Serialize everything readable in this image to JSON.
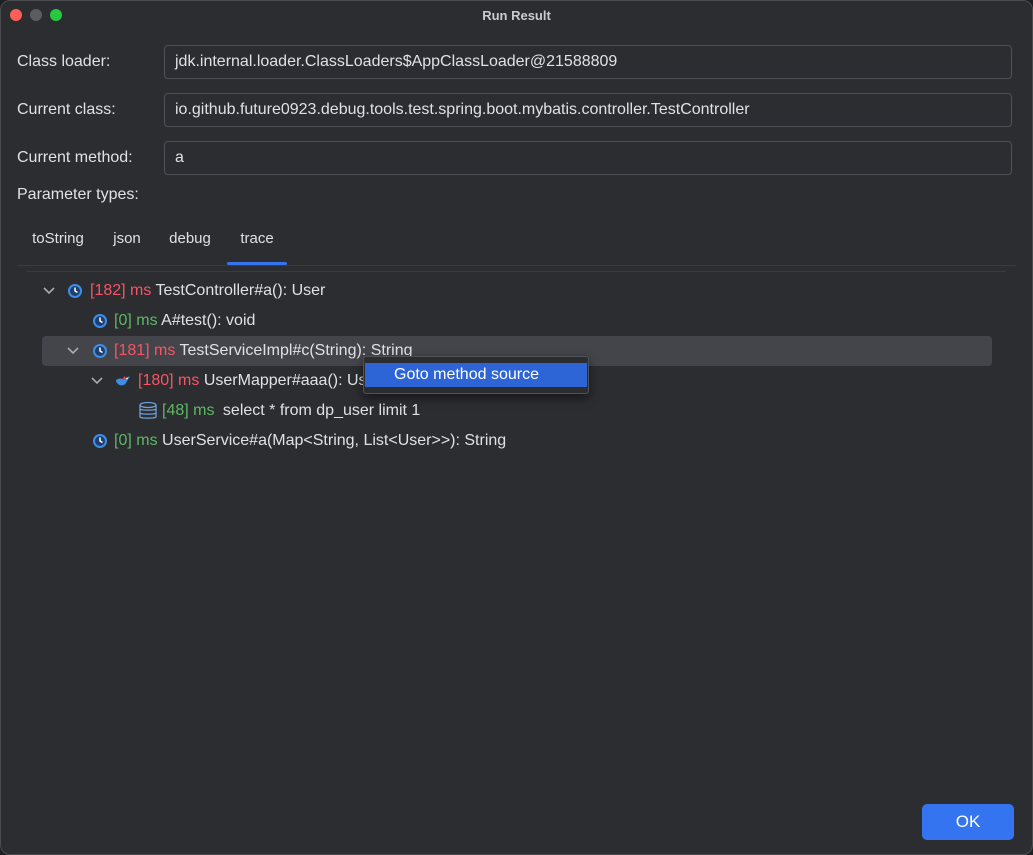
{
  "window": {
    "title": "Run Result"
  },
  "form": {
    "class_loader_label": "Class loader:",
    "class_loader_value": "jdk.internal.loader.ClassLoaders$AppClassLoader@21588809",
    "current_class_label": "Current class:",
    "current_class_value": "io.github.future0923.debug.tools.test.spring.boot.mybatis.controller.TestController",
    "current_method_label": "Current method:",
    "current_method_value": "a",
    "parameter_types_label": "Parameter types:"
  },
  "tabs": [
    {
      "label": "toString",
      "active": false
    },
    {
      "label": "json",
      "active": false
    },
    {
      "label": "debug",
      "active": false
    },
    {
      "label": "trace",
      "active": true
    }
  ],
  "trace_tree": [
    {
      "cost": "[182]",
      "unit": "ms",
      "signature": "TestController#a(): User",
      "icon": "clock-icon",
      "expanded": true,
      "cost_color": "#f75464"
    },
    {
      "cost": "[0]",
      "unit": "ms",
      "signature": "A#test(): void",
      "icon": "clock-icon",
      "cost_color": "#5fb865"
    },
    {
      "cost": "[181]",
      "unit": "ms",
      "signature": "TestServiceImpl#c(String): String",
      "icon": "clock-icon",
      "expanded": true,
      "selected": true,
      "cost_color": "#f75464"
    },
    {
      "cost": "[180]",
      "unit": "ms",
      "signature": "UserMapper#aaa(): User",
      "icon": "mybatis-bird-icon",
      "expanded": true,
      "cost_color": "#f75464"
    },
    {
      "cost": "[48]",
      "unit": "ms",
      "signature": "select * from dp_user limit 1",
      "icon": "database-icon",
      "cost_color": "#5fb865"
    },
    {
      "cost": "[0]",
      "unit": "ms",
      "signature": "UserService#a(Map<String, List<User>>): String",
      "icon": "clock-icon",
      "cost_color": "#5fb865"
    }
  ],
  "context_menu": {
    "items": [
      {
        "label": "Goto method source",
        "highlighted": true
      }
    ]
  },
  "buttons": {
    "ok_label": "OK"
  },
  "colors": {
    "accent": "#3574f0",
    "cost_slow": "#f75464",
    "cost_fast": "#5fb865",
    "background": "#2b2d30"
  }
}
